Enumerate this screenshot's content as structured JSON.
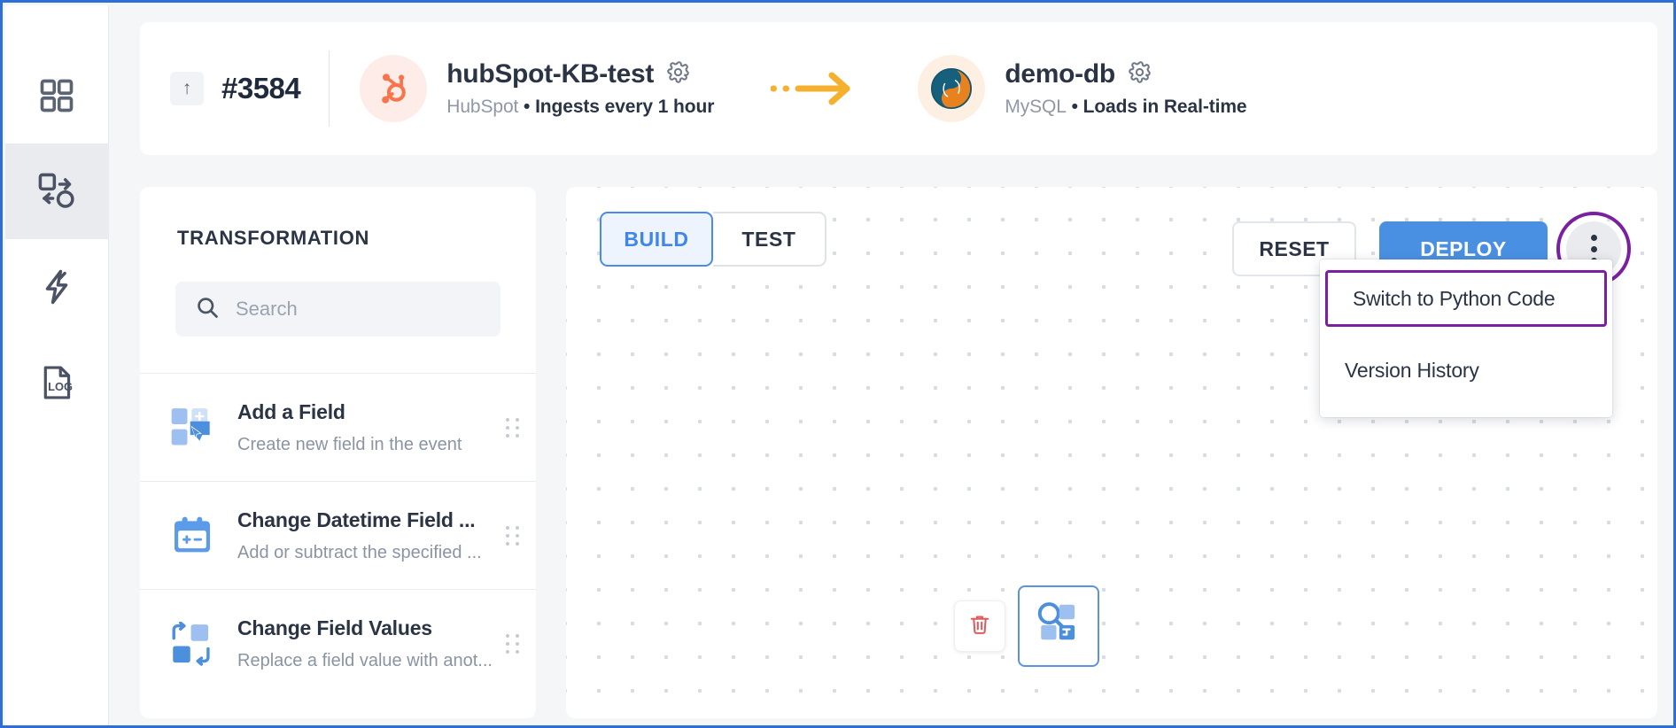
{
  "rail": {
    "items": [
      {
        "name": "dashboard",
        "icon": "grid-icon",
        "active": false
      },
      {
        "name": "pipelines",
        "icon": "transform-icon",
        "active": true
      },
      {
        "name": "events",
        "icon": "bolt-icon",
        "active": false
      },
      {
        "name": "logs",
        "icon": "log-file-icon",
        "active": false
      }
    ]
  },
  "header": {
    "up_arrow": "↑",
    "pipeline_id": "#3584",
    "source": {
      "title": "hubSpot-KB-test",
      "connector": "HubSpot",
      "separator": "•",
      "schedule": "Ingests every 1 hour",
      "logo": "hubspot-logo",
      "settings_icon": "gear-icon"
    },
    "destination": {
      "title": "demo-db",
      "connector": "MySQL",
      "separator": "•",
      "schedule": "Loads in Real-time",
      "logo": "mysql-dolphin-logo",
      "settings_icon": "gear-icon"
    },
    "flow_arrow_color": "#f5b02e"
  },
  "transformation_panel": {
    "title": "TRANSFORMATION",
    "search": {
      "value": "",
      "placeholder": "Search",
      "icon": "search-icon"
    },
    "items": [
      {
        "name": "Add a Field",
        "description": "Create new field in the event",
        "icon": "add-field-icon"
      },
      {
        "name": "Change Datetime Field ...",
        "description": "Add or subtract the specified ...",
        "icon": "calendar-plus-minus-icon"
      },
      {
        "name": "Change Field Values",
        "description": "Replace a field value with anot...",
        "icon": "swap-values-icon"
      }
    ]
  },
  "canvas": {
    "tabs": [
      {
        "label": "BUILD",
        "selected": true
      },
      {
        "label": "TEST",
        "selected": false
      }
    ],
    "reset_label": "RESET",
    "deploy_label": "DEPLOY",
    "kebab_icon": "more-vertical-icon",
    "menu": {
      "items": [
        {
          "label": "Switch to Python Code",
          "highlighted": true
        },
        {
          "label": "Version History",
          "highlighted": false
        }
      ]
    },
    "node": {
      "delete_icon": "trash-icon",
      "node_icon": "inspect-field-icon"
    }
  },
  "colors": {
    "accent_blue": "#4a90e2",
    "highlight_purple": "#7b1fa2",
    "arrow_orange": "#f5b02e",
    "text_dark": "#2b3445",
    "text_muted": "#8a94a3"
  }
}
